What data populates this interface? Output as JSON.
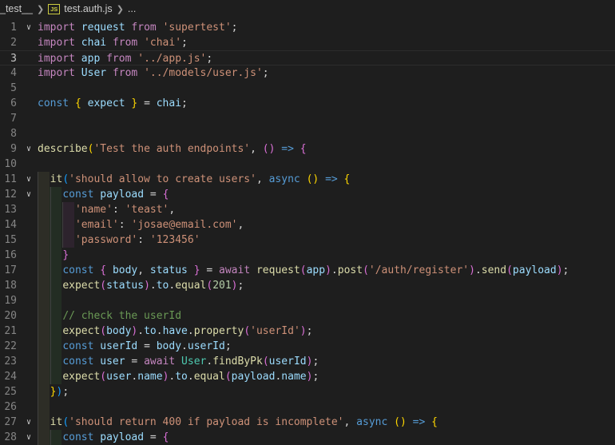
{
  "breadcrumb": {
    "folder": "_test__",
    "file_icon": "js-file-icon",
    "file_icon_text": "JS",
    "file": "test.auth.js",
    "tail": "..."
  },
  "editor": {
    "current_line": 3,
    "lines": [
      {
        "n": "1",
        "fold": true,
        "guides": 0,
        "tokens": [
          [
            "kw",
            "import"
          ],
          [
            "p",
            " "
          ],
          [
            "var",
            "request"
          ],
          [
            "p",
            " "
          ],
          [
            "kw",
            "from"
          ],
          [
            "p",
            " "
          ],
          [
            "st",
            "'supertest'"
          ],
          [
            "p",
            ";"
          ]
        ]
      },
      {
        "n": "2",
        "fold": false,
        "guides": 0,
        "tokens": [
          [
            "kw",
            "import"
          ],
          [
            "p",
            " "
          ],
          [
            "var",
            "chai"
          ],
          [
            "p",
            " "
          ],
          [
            "kw",
            "from"
          ],
          [
            "p",
            " "
          ],
          [
            "st",
            "'chai'"
          ],
          [
            "p",
            ";"
          ]
        ]
      },
      {
        "n": "3",
        "fold": false,
        "guides": 0,
        "tokens": [
          [
            "kw",
            "import"
          ],
          [
            "p",
            " "
          ],
          [
            "var",
            "app"
          ],
          [
            "p",
            " "
          ],
          [
            "kw",
            "from"
          ],
          [
            "p",
            " "
          ],
          [
            "st",
            "'../app.js'"
          ],
          [
            "p",
            ";"
          ]
        ]
      },
      {
        "n": "4",
        "fold": false,
        "guides": 0,
        "tokens": [
          [
            "kw",
            "import"
          ],
          [
            "p",
            " "
          ],
          [
            "var",
            "User"
          ],
          [
            "p",
            " "
          ],
          [
            "kw",
            "from"
          ],
          [
            "p",
            " "
          ],
          [
            "st",
            "'../models/user.js'"
          ],
          [
            "p",
            ";"
          ]
        ]
      },
      {
        "n": "5",
        "fold": false,
        "guides": 0,
        "tokens": []
      },
      {
        "n": "6",
        "fold": false,
        "guides": 0,
        "tokens": [
          [
            "con",
            "const"
          ],
          [
            "p",
            " "
          ],
          [
            "b1",
            "{"
          ],
          [
            "p",
            " "
          ],
          [
            "var",
            "expect"
          ],
          [
            "p",
            " "
          ],
          [
            "b1",
            "}"
          ],
          [
            "p",
            " = "
          ],
          [
            "var",
            "chai"
          ],
          [
            "p",
            ";"
          ]
        ]
      },
      {
        "n": "7",
        "fold": false,
        "guides": 0,
        "tokens": []
      },
      {
        "n": "8",
        "fold": false,
        "guides": 0,
        "tokens": []
      },
      {
        "n": "9",
        "fold": true,
        "guides": 0,
        "tokens": [
          [
            "fn",
            "describe"
          ],
          [
            "b1",
            "("
          ],
          [
            "st",
            "'Test the auth endpoints'"
          ],
          [
            "p",
            ", "
          ],
          [
            "b2",
            "()"
          ],
          [
            "p",
            " "
          ],
          [
            "con",
            "=>"
          ],
          [
            "p",
            " "
          ],
          [
            "b2",
            "{"
          ]
        ]
      },
      {
        "n": "10",
        "fold": false,
        "guides": 0,
        "tokens": []
      },
      {
        "n": "11",
        "fold": true,
        "guides": 1,
        "tokens": [
          [
            "p",
            "  "
          ],
          [
            "fn",
            "it"
          ],
          [
            "b3",
            "("
          ],
          [
            "st",
            "'should allow to create users'"
          ],
          [
            "p",
            ", "
          ],
          [
            "con",
            "async"
          ],
          [
            "p",
            " "
          ],
          [
            "b1",
            "()"
          ],
          [
            "p",
            " "
          ],
          [
            "con",
            "=>"
          ],
          [
            "p",
            " "
          ],
          [
            "b1",
            "{"
          ]
        ]
      },
      {
        "n": "12",
        "fold": true,
        "guides": 2,
        "tokens": [
          [
            "p",
            "    "
          ],
          [
            "con",
            "const"
          ],
          [
            "p",
            " "
          ],
          [
            "var",
            "payload"
          ],
          [
            "p",
            " = "
          ],
          [
            "b2",
            "{"
          ]
        ]
      },
      {
        "n": "13",
        "fold": false,
        "guides": 3,
        "tokens": [
          [
            "p",
            "      "
          ],
          [
            "st",
            "'name'"
          ],
          [
            "p",
            ": "
          ],
          [
            "st",
            "'teast'"
          ],
          [
            "p",
            ","
          ]
        ]
      },
      {
        "n": "14",
        "fold": false,
        "guides": 3,
        "tokens": [
          [
            "p",
            "      "
          ],
          [
            "st",
            "'email'"
          ],
          [
            "p",
            ": "
          ],
          [
            "st",
            "'josae@email.com'"
          ],
          [
            "p",
            ","
          ]
        ]
      },
      {
        "n": "15",
        "fold": false,
        "guides": 3,
        "tokens": [
          [
            "p",
            "      "
          ],
          [
            "st",
            "'password'"
          ],
          [
            "p",
            ": "
          ],
          [
            "st",
            "'123456'"
          ]
        ]
      },
      {
        "n": "16",
        "fold": false,
        "guides": 2,
        "tokens": [
          [
            "p",
            "    "
          ],
          [
            "b2",
            "}"
          ]
        ]
      },
      {
        "n": "17",
        "fold": false,
        "guides": 2,
        "tokens": [
          [
            "p",
            "    "
          ],
          [
            "con",
            "const"
          ],
          [
            "p",
            " "
          ],
          [
            "b2",
            "{"
          ],
          [
            "p",
            " "
          ],
          [
            "var",
            "body"
          ],
          [
            "p",
            ", "
          ],
          [
            "var",
            "status"
          ],
          [
            "p",
            " "
          ],
          [
            "b2",
            "}"
          ],
          [
            "p",
            " = "
          ],
          [
            "kw",
            "await"
          ],
          [
            "p",
            " "
          ],
          [
            "fn",
            "request"
          ],
          [
            "b2",
            "("
          ],
          [
            "var",
            "app"
          ],
          [
            "b2",
            ")"
          ],
          [
            "p",
            "."
          ],
          [
            "fn",
            "post"
          ],
          [
            "b2",
            "("
          ],
          [
            "st",
            "'/auth/register'"
          ],
          [
            "b2",
            ")"
          ],
          [
            "p",
            "."
          ],
          [
            "fn",
            "send"
          ],
          [
            "b2",
            "("
          ],
          [
            "var",
            "payload"
          ],
          [
            "b2",
            ")"
          ],
          [
            "p",
            ";"
          ]
        ]
      },
      {
        "n": "18",
        "fold": false,
        "guides": 2,
        "tokens": [
          [
            "p",
            "    "
          ],
          [
            "fn",
            "expect"
          ],
          [
            "b2",
            "("
          ],
          [
            "var",
            "status"
          ],
          [
            "b2",
            ")"
          ],
          [
            "p",
            "."
          ],
          [
            "var",
            "to"
          ],
          [
            "p",
            "."
          ],
          [
            "fn",
            "equal"
          ],
          [
            "b2",
            "("
          ],
          [
            "num",
            "201"
          ],
          [
            "b2",
            ")"
          ],
          [
            "p",
            ";"
          ]
        ]
      },
      {
        "n": "19",
        "fold": false,
        "guides": 2,
        "tokens": []
      },
      {
        "n": "20",
        "fold": false,
        "guides": 2,
        "tokens": [
          [
            "p",
            "    "
          ],
          [
            "com",
            "// check the userId"
          ]
        ]
      },
      {
        "n": "21",
        "fold": false,
        "guides": 2,
        "tokens": [
          [
            "p",
            "    "
          ],
          [
            "fn",
            "expect"
          ],
          [
            "b2",
            "("
          ],
          [
            "var",
            "body"
          ],
          [
            "b2",
            ")"
          ],
          [
            "p",
            "."
          ],
          [
            "var",
            "to"
          ],
          [
            "p",
            "."
          ],
          [
            "var",
            "have"
          ],
          [
            "p",
            "."
          ],
          [
            "fn",
            "property"
          ],
          [
            "b2",
            "("
          ],
          [
            "st",
            "'userId'"
          ],
          [
            "b2",
            ")"
          ],
          [
            "p",
            ";"
          ]
        ]
      },
      {
        "n": "22",
        "fold": false,
        "guides": 2,
        "tokens": [
          [
            "p",
            "    "
          ],
          [
            "con",
            "const"
          ],
          [
            "p",
            " "
          ],
          [
            "var",
            "userId"
          ],
          [
            "p",
            " = "
          ],
          [
            "var",
            "body"
          ],
          [
            "p",
            "."
          ],
          [
            "var",
            "userId"
          ],
          [
            "p",
            ";"
          ]
        ]
      },
      {
        "n": "23",
        "fold": false,
        "guides": 2,
        "tokens": [
          [
            "p",
            "    "
          ],
          [
            "con",
            "const"
          ],
          [
            "p",
            " "
          ],
          [
            "var",
            "user"
          ],
          [
            "p",
            " = "
          ],
          [
            "kw",
            "await"
          ],
          [
            "p",
            " "
          ],
          [
            "cls",
            "User"
          ],
          [
            "p",
            "."
          ],
          [
            "fn",
            "findByPk"
          ],
          [
            "b2",
            "("
          ],
          [
            "var",
            "userId"
          ],
          [
            "b2",
            ")"
          ],
          [
            "p",
            ";"
          ]
        ]
      },
      {
        "n": "24",
        "fold": false,
        "guides": 2,
        "tokens": [
          [
            "p",
            "    "
          ],
          [
            "fn",
            "expect"
          ],
          [
            "b2",
            "("
          ],
          [
            "var",
            "user"
          ],
          [
            "p",
            "."
          ],
          [
            "var",
            "name"
          ],
          [
            "b2",
            ")"
          ],
          [
            "p",
            "."
          ],
          [
            "var",
            "to"
          ],
          [
            "p",
            "."
          ],
          [
            "fn",
            "equal"
          ],
          [
            "b2",
            "("
          ],
          [
            "var",
            "payload"
          ],
          [
            "p",
            "."
          ],
          [
            "var",
            "name"
          ],
          [
            "b2",
            ")"
          ],
          [
            "p",
            ";"
          ]
        ]
      },
      {
        "n": "25",
        "fold": false,
        "guides": 1,
        "tokens": [
          [
            "p",
            "  "
          ],
          [
            "b1",
            "}"
          ],
          [
            "b3",
            ")"
          ],
          [
            "p",
            ";"
          ]
        ]
      },
      {
        "n": "26",
        "fold": false,
        "guides": 1,
        "tokens": []
      },
      {
        "n": "27",
        "fold": true,
        "guides": 1,
        "tokens": [
          [
            "p",
            "  "
          ],
          [
            "fn",
            "it"
          ],
          [
            "b3",
            "("
          ],
          [
            "st",
            "'should return 400 if payload is incomplete'"
          ],
          [
            "p",
            ", "
          ],
          [
            "con",
            "async"
          ],
          [
            "p",
            " "
          ],
          [
            "b1",
            "()"
          ],
          [
            "p",
            " "
          ],
          [
            "con",
            "=>"
          ],
          [
            "p",
            " "
          ],
          [
            "b1",
            "{"
          ]
        ]
      },
      {
        "n": "28",
        "fold": true,
        "guides": 2,
        "tokens": [
          [
            "p",
            "    "
          ],
          [
            "con",
            "const"
          ],
          [
            "p",
            " "
          ],
          [
            "var",
            "payload"
          ],
          [
            "p",
            " = "
          ],
          [
            "b2",
            "{"
          ]
        ]
      }
    ]
  }
}
